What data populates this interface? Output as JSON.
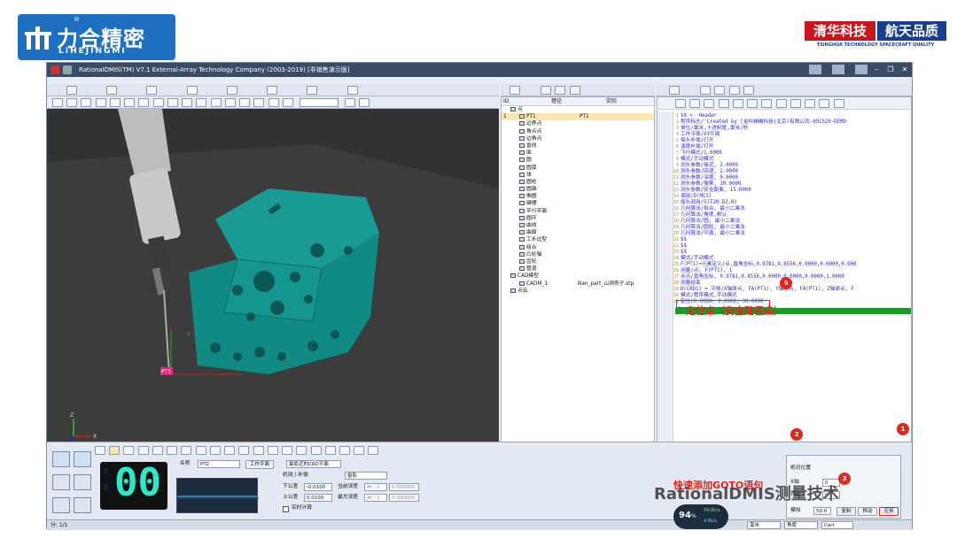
{
  "slide": {
    "logo": {
      "cn": "力合精密",
      "en": "LIHEJINGMI",
      "reg": "®"
    },
    "brand": {
      "red_text": "清华科技",
      "blue_text": "航天品质",
      "sub": "TSINGHUA TECHNOLOGY SPACECRAFT QUALITY"
    },
    "annotation_safe_point": "定位点（安全路径点）",
    "annotation_goto": "快速添加GOTO语句",
    "watermark": "RationalDMIS测量技术",
    "page_number": "13",
    "badges": [
      "1",
      "2",
      "3",
      "5"
    ],
    "gauge": {
      "value": "94",
      "unit": "%",
      "up": "34.8k/s",
      "down": "4.6k/s"
    }
  },
  "window": {
    "title": "RationalDMIS(TM) V7.1   External-Array Technology Company (2003-2019)  [非销售演示版]",
    "controls": [
      "–",
      "❐",
      "✕"
    ]
  },
  "viewport": {
    "point_label": "PT1",
    "axis_labels": {
      "x": "X",
      "y": "Y",
      "z": "Z"
    },
    "combo_value": ""
  },
  "tree": {
    "headers": [
      "ID",
      "理论",
      "实际"
    ],
    "rows": [
      {
        "indent": 0,
        "label": "点",
        "sel": false
      },
      {
        "indent": 1,
        "label": "PT1",
        "col2": "PT1",
        "sel": true,
        "id": "1"
      },
      {
        "indent": 1,
        "label": "边界点",
        "sel": false
      },
      {
        "indent": 1,
        "label": "角点点",
        "sel": false
      },
      {
        "indent": 1,
        "label": "边角点",
        "sel": false
      },
      {
        "indent": 1,
        "label": "直线",
        "sel": false
      },
      {
        "indent": 1,
        "label": "面",
        "sel": false
      },
      {
        "indent": 1,
        "label": "圆",
        "sel": false
      },
      {
        "indent": 1,
        "label": "圆弧",
        "sel": false
      },
      {
        "indent": 1,
        "label": "球",
        "sel": false
      },
      {
        "indent": 1,
        "label": "圆柱",
        "sel": false
      },
      {
        "indent": 1,
        "label": "圆锥",
        "sel": false
      },
      {
        "indent": 1,
        "label": "椭圆",
        "sel": false
      },
      {
        "indent": 1,
        "label": "键槽",
        "sel": false
      },
      {
        "indent": 1,
        "label": "平行平面",
        "sel": false
      },
      {
        "indent": 1,
        "label": "圆环",
        "sel": false
      },
      {
        "indent": 1,
        "label": "曲线",
        "sel": false
      },
      {
        "indent": 1,
        "label": "曲面",
        "sel": false
      },
      {
        "indent": 1,
        "label": "工步边型",
        "sel": false
      },
      {
        "indent": 1,
        "label": "组合",
        "sel": false
      },
      {
        "indent": 1,
        "label": "凸轮轴",
        "sel": false
      },
      {
        "indent": 1,
        "label": "齿轮",
        "sel": false
      },
      {
        "indent": 1,
        "label": "管道",
        "sel": false
      },
      {
        "indent": 0,
        "label": "CAD模型",
        "sel": false
      },
      {
        "indent": 1,
        "label": "CADM_1",
        "col2": "Nan_part_山洞壳子.stp",
        "sel": false
      },
      {
        "indent": 0,
        "label": "点云",
        "sel": false
      }
    ]
  },
  "code": {
    "lines": [
      {
        "n": "1",
        "t": "$$ <- Header"
      },
      {
        "n": "2",
        "t": "程序标志/'Created by [金科精确科技(北京)有限公司-091520-DEMO"
      },
      {
        "n": "3",
        "t": "单位/毫米,十进制度,毫米/秒"
      },
      {
        "n": "4",
        "t": "工作平面/XY平面"
      },
      {
        "n": "5",
        "t": "探头补偿/打开"
      },
      {
        "n": "6",
        "t": "温度补偿/打开"
      },
      {
        "n": "7",
        "t": "飞行模式/1.0000"
      },
      {
        "n": "8",
        "t": "模式/手动模式"
      },
      {
        "n": "9",
        "t": "测头参数/接近, 2.0000"
      },
      {
        "n": "10",
        "t": "测头参数/回退, 2.0000"
      },
      {
        "n": "11",
        "t": "测头参数/深度, 0.0000"
      },
      {
        "n": "12",
        "t": "测头参数/搜索, 10.0000"
      },
      {
        "n": "13",
        "t": "测头参数/安全距离, 15.0000"
      },
      {
        "n": "14",
        "t": "调用/D(MCS)"
      },
      {
        "n": "15",
        "t": "探头调用/S(T20-D2.0)"
      },
      {
        "n": "16",
        "t": "几何算法/拟合, 最小二乘法"
      },
      {
        "n": "17",
        "t": "几何算法/角度,默认"
      },
      {
        "n": "18",
        "t": "几何算法/圆, 最小二乘法"
      },
      {
        "n": "19",
        "t": "几何算法/圆柱, 最小二乘法"
      },
      {
        "n": "20",
        "t": "几何算法/平面, 最小二乘法"
      },
      {
        "n": "21",
        "t": "$$"
      },
      {
        "n": "22",
        "t": "$$"
      },
      {
        "n": "23",
        "t": "$$"
      },
      {
        "n": "24",
        "t": "模式/手动模式"
      },
      {
        "n": "25",
        "t": "F(PT1)=元素定义/点,直角坐标,0.9781,0.8556,0.0000,0.0000,0.000"
      },
      {
        "n": "26",
        "t": "测量/点, F(PT1), 1"
      },
      {
        "n": "27",
        "t": "  点点/直角坐标, 0.9781,0.8556,0.0000,0.0000,0.0000,1.0000"
      },
      {
        "n": "28",
        "t": "测量结束"
      },
      {
        "n": "29",
        "t": "D(CRD1) = 平移/X轴原点, FA(PT1), Y轴原点, FA(PT1), Z轴原点, F"
      },
      {
        "n": "30",
        "t": "模式/程序模式,手动模式"
      },
      {
        "n": "31",
        "t": "定位/0.0000, 0.0000, 30.0000"
      }
    ]
  },
  "bottom": {
    "big_number": "00",
    "name_label": "名称",
    "name_value": "PT2",
    "workplane_btn": "工作平面",
    "crd_combo": "最靠近的CRD平面",
    "probe_comp_label": "机测 / 补偿",
    "proj_combo": "投影",
    "lower_tol_label": "下公差",
    "lower_tol_value": "-0.0100",
    "upper_tol_label": "上公差",
    "upper_tol_value": "0.0100",
    "cur_err_label": "当前误差",
    "max_err_label": "最大误差",
    "at_label_1": "At : 1",
    "at_label_2": "At : 1",
    "at_val_1": "0.000000",
    "at_val_2": "0.000000",
    "realtime_label": "实时计算",
    "goto_abs_label": "绝对位置",
    "goto_x_label": "X轴",
    "goto_y_label": "Y轴",
    "goto_x_val": "0",
    "goto_y_val": "0",
    "goto_unit_label": "模拟",
    "goto_speed": "50.0",
    "goto_btn1": "复制",
    "goto_btn2": "移动",
    "goto_btn3": "应用"
  },
  "status": {
    "left": "分: 1/1",
    "unit": "毫米",
    "angle": "角度",
    "cart": "Cart",
    "dropdowns": [
      "毫米",
      "角度",
      "Cart"
    ]
  },
  "colors": {
    "part": "#1a8f8a",
    "panel": "#e8edf4",
    "accent_red": "#e0281e",
    "brand_blue": "#1f6fc0"
  }
}
